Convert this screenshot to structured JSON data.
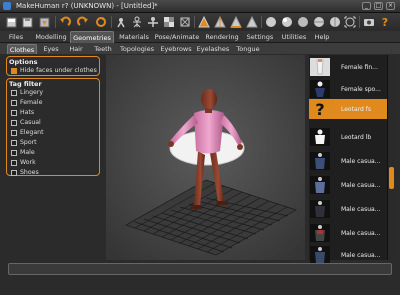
{
  "window": {
    "title": "MakeHuman r? (UNKNOWN) - [Untitled]*"
  },
  "toolbar": {
    "icons": [
      "undo-icon",
      "redo-icon",
      "reset-icon",
      "smooth-icon",
      "wireframe-icon",
      "background-icon",
      "grid-icon",
      "front-view-icon",
      "back-view-icon",
      "left-view-icon",
      "right-view-icon",
      "top-view-icon",
      "bottom-view-icon",
      "reset-camera-icon",
      "screenshot-icon",
      "help-icon"
    ],
    "accent": "#e08a1e"
  },
  "main_tabs": [
    "Files",
    "Modelling",
    "Geometries",
    "Materials",
    "Pose/Animate",
    "Rendering",
    "Settings",
    "Utilities",
    "Help"
  ],
  "main_active": "Geometries",
  "sub_tabs": [
    "Clothes",
    "Eyes",
    "Hair",
    "Teeth",
    "Topologies",
    "Eyebrows",
    "Eyelashes",
    "Tongue"
  ],
  "sub_active": "Clothes",
  "options": {
    "title": "Options",
    "hide_faces": "Hide faces under clothes"
  },
  "tag_filter": {
    "title": "Tag filter",
    "tags": [
      "Lingery",
      "Female",
      "Hats",
      "Casual",
      "Elegant",
      "Sport",
      "Male",
      "Work",
      "Shoes"
    ]
  },
  "library": {
    "items": [
      {
        "label": "Female fin...",
        "selected": false
      },
      {
        "label": "Female spo...",
        "selected": false
      },
      {
        "label": "Leotard fs",
        "selected": true
      },
      {
        "label": "Leotard lb",
        "selected": false
      },
      {
        "label": "Male casua...",
        "selected": false
      },
      {
        "label": "Male casua...",
        "selected": false
      },
      {
        "label": "Male casua...",
        "selected": false
      },
      {
        "label": "Male casua...",
        "selected": false
      },
      {
        "label": "Male casua...",
        "selected": false
      }
    ]
  },
  "status": {
    "text": ""
  }
}
